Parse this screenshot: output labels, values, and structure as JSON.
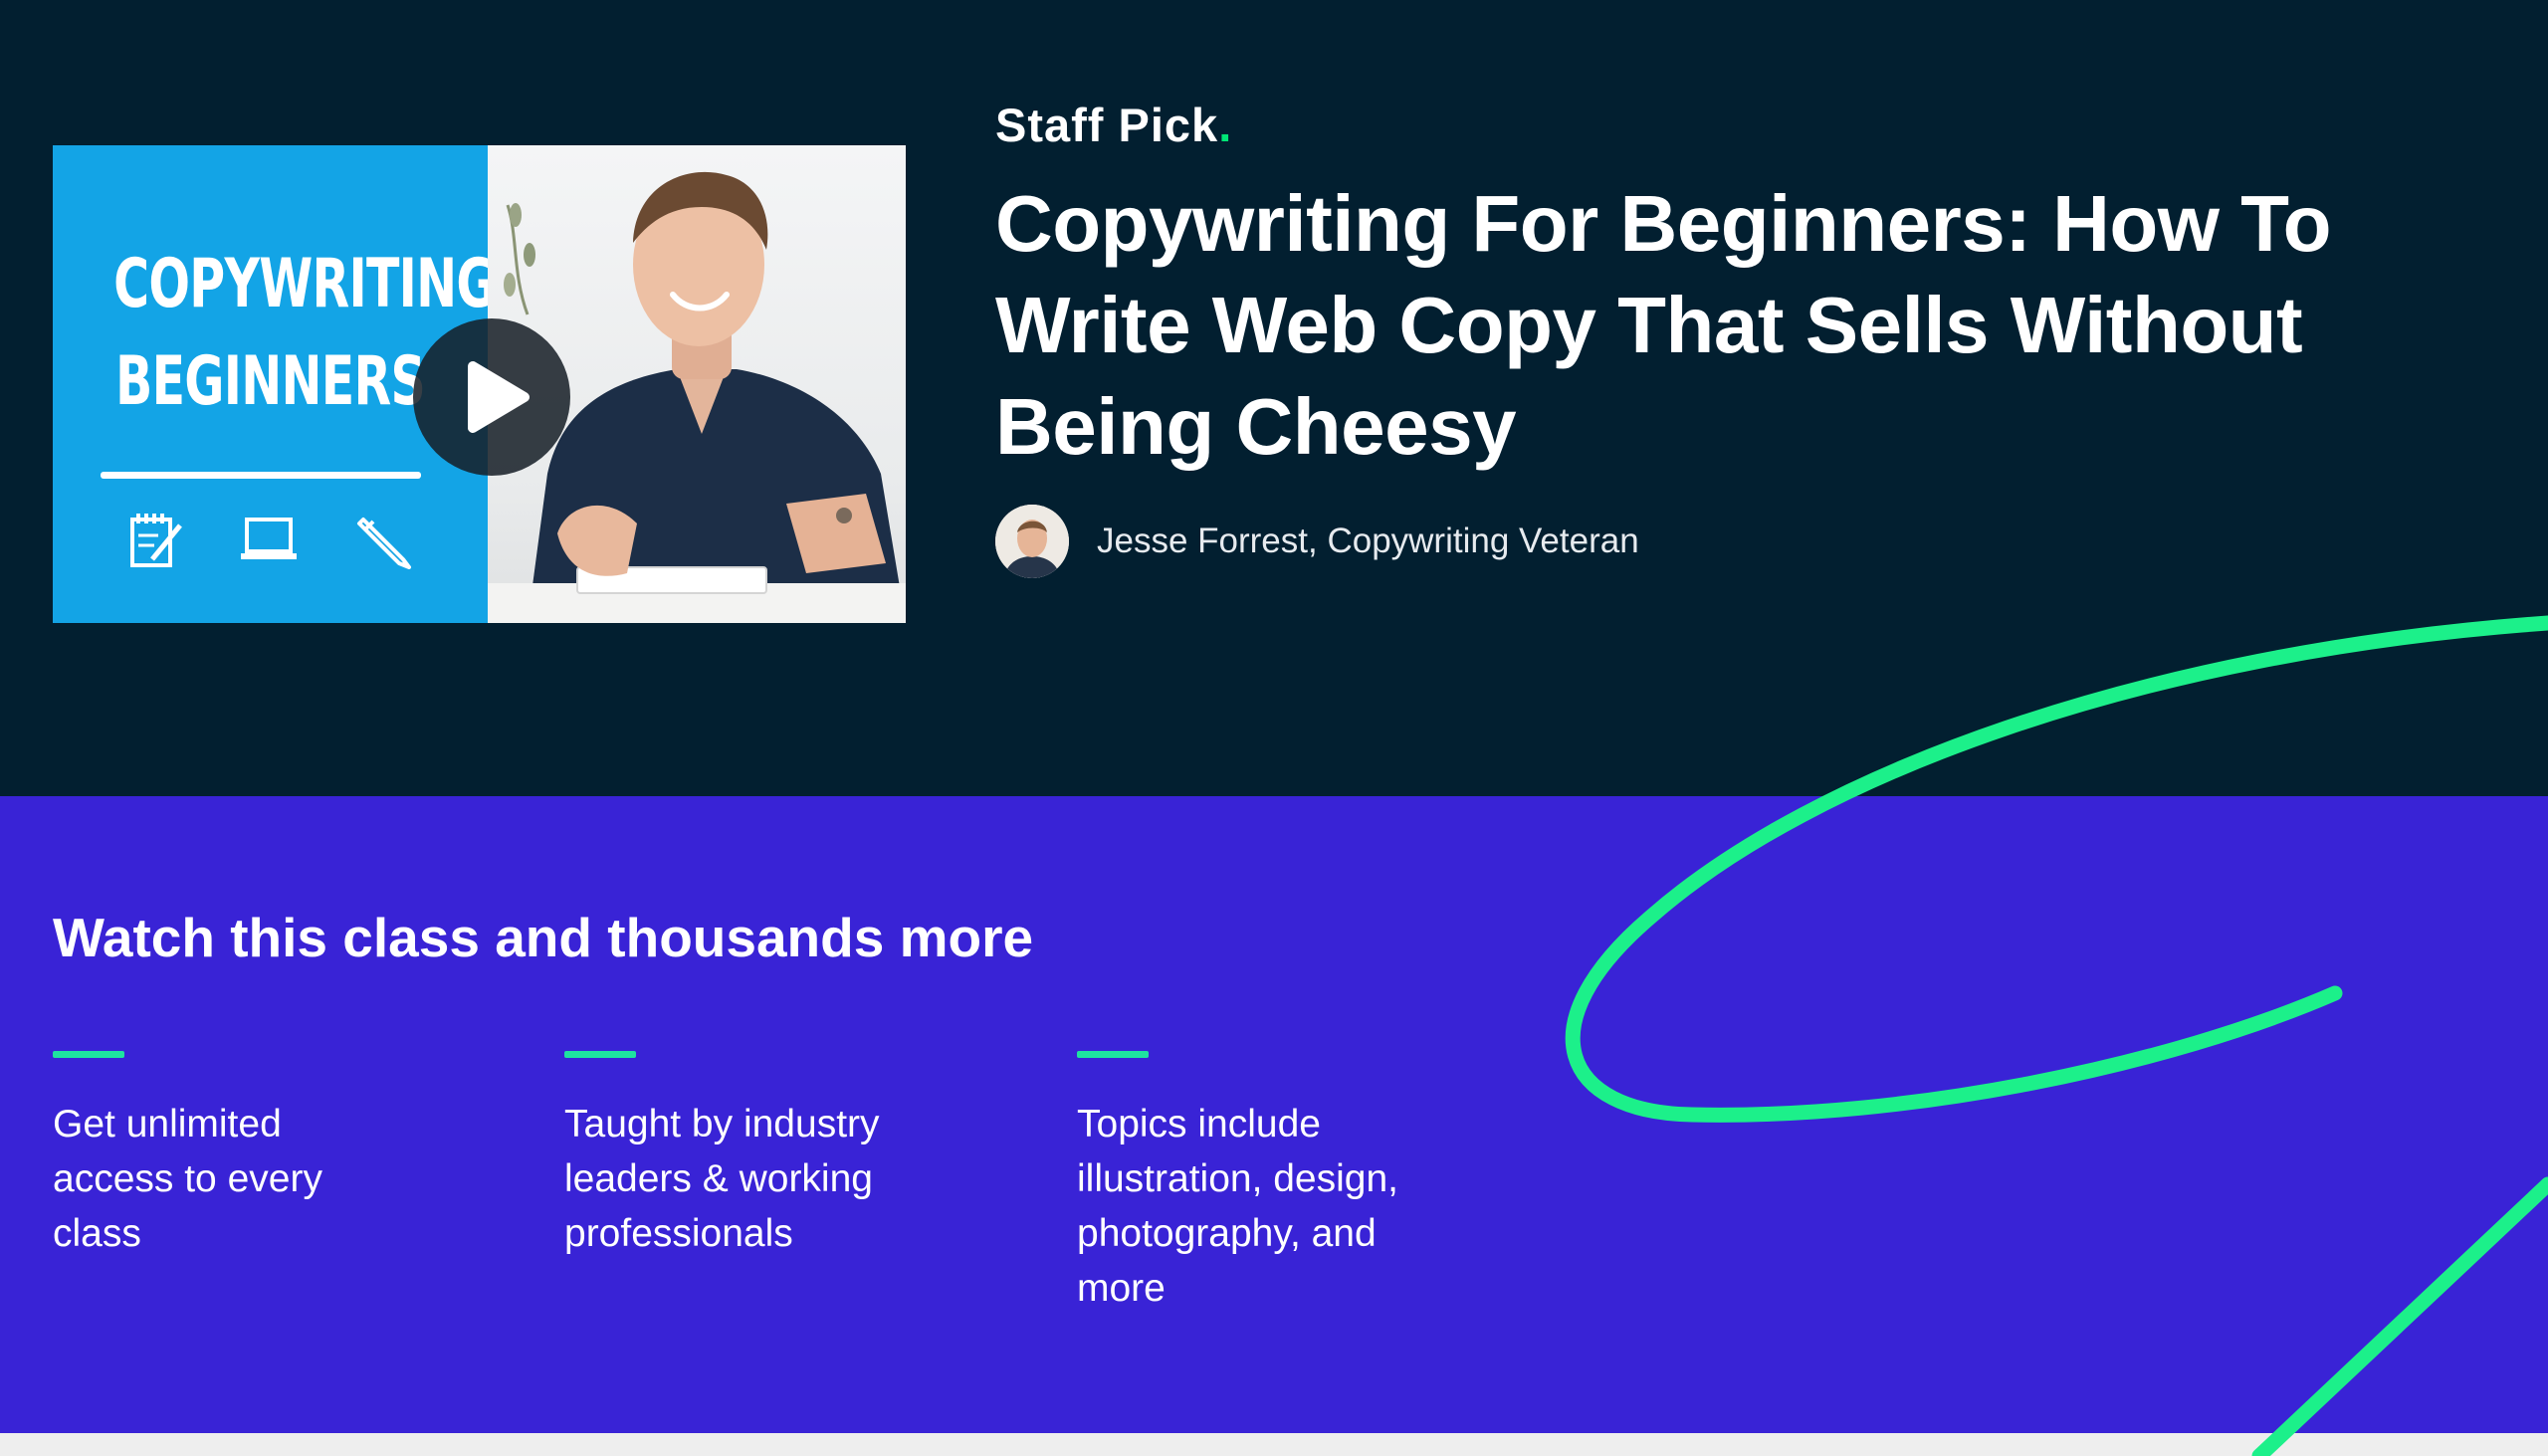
{
  "hero": {
    "staff_pick_label": "Staff Pick",
    "staff_pick_dot": ".",
    "title": "Copywriting For Beginners: How To Write Web Copy That Sells Without Being Cheesy",
    "teacher": "Jesse Forrest, Copywriting Veteran",
    "thumbnail": {
      "line1": "COPYWRITING",
      "line2": "BEGINNERS",
      "icons": [
        "notepad-icon",
        "laptop-icon",
        "pencil-icon"
      ]
    },
    "play_icon": "play-icon"
  },
  "promo": {
    "heading": "Watch this class and thousands more",
    "features": [
      {
        "text": "Get unlimited access to every class"
      },
      {
        "text": "Taught by industry leaders & working professionals"
      },
      {
        "text": "Topics include illustration, design, photography, and more"
      }
    ]
  },
  "colors": {
    "hero_bg": "#021f30",
    "promo_bg": "#3923d6",
    "accent_green": "#00e676",
    "feature_bar": "#1ee3a0",
    "thumb_blue": "#13a4e6"
  }
}
